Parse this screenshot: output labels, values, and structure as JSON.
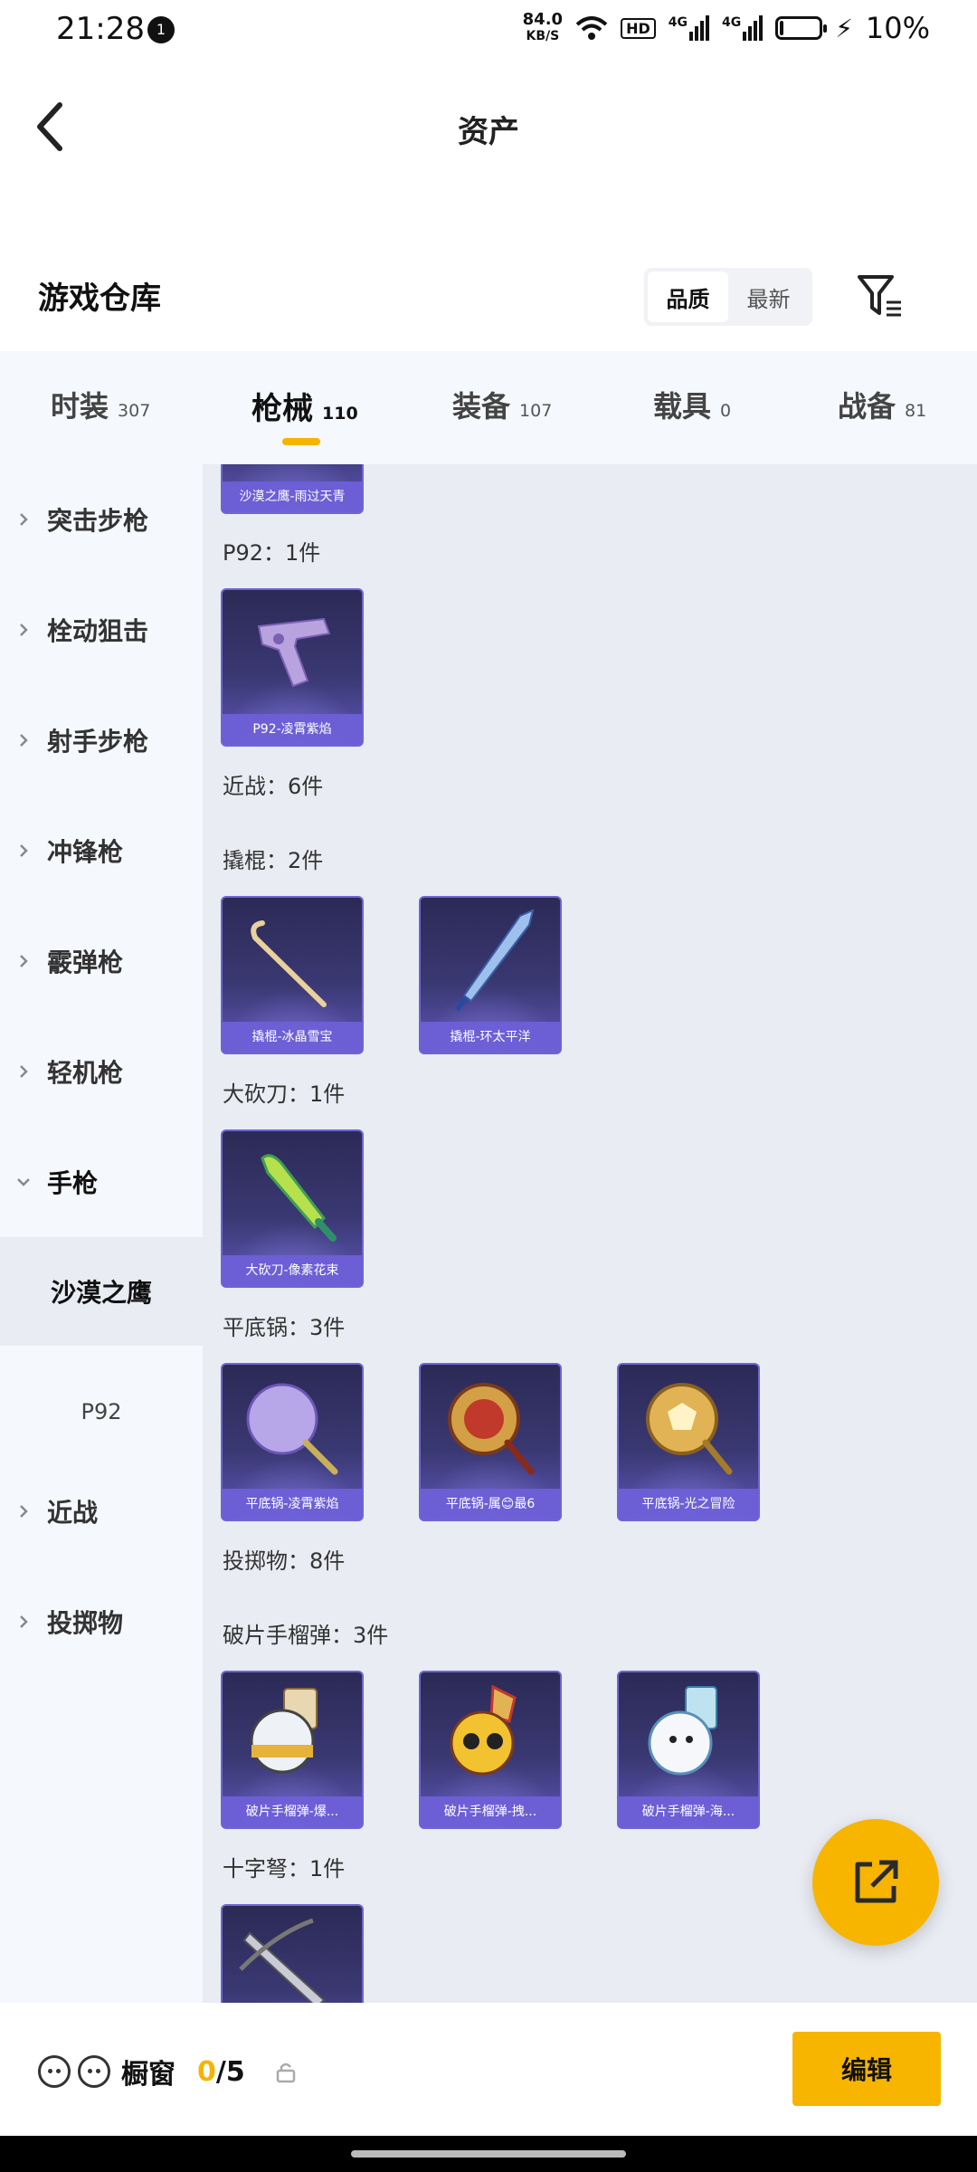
{
  "status_bar": {
    "time": "21:28",
    "notification_count": "1",
    "net_speed": "84.0",
    "net_unit": "KB/S",
    "hd": "HD",
    "signal1": "4G",
    "signal2": "4G",
    "battery": "10%",
    "battery_level": 0.1
  },
  "header": {
    "title": "资产"
  },
  "section": {
    "title": "游戏仓库"
  },
  "sort": {
    "quality": "品质",
    "latest": "最新",
    "active": "quality"
  },
  "tabs": [
    {
      "label": "时装",
      "count": "307"
    },
    {
      "label": "枪械",
      "count": "110"
    },
    {
      "label": "装备",
      "count": "107"
    },
    {
      "label": "载具",
      "count": "0"
    },
    {
      "label": "战备",
      "count": "81"
    }
  ],
  "active_tab": 1,
  "sidebar": {
    "items": [
      {
        "label": "突击步枪"
      },
      {
        "label": "栓动狙击"
      },
      {
        "label": "射手步枪"
      },
      {
        "label": "冲锋枪"
      },
      {
        "label": "霰弹枪"
      },
      {
        "label": "轻机枪"
      },
      {
        "label": "手枪"
      },
      {
        "label": "近战"
      },
      {
        "label": "投掷物"
      }
    ],
    "sub_items": [
      {
        "label": "沙漠之鹰"
      },
      {
        "label": "P92"
      }
    ]
  },
  "content": {
    "top_card": "沙漠之鹰-雨过天青",
    "groups": [
      {
        "label": "P92：1件",
        "cards": [
          "P92-凌霄紫焰"
        ]
      },
      {
        "label": "近战：6件",
        "cards": []
      },
      {
        "label": "撬棍：2件",
        "cards": [
          "撬棍-冰晶雪宝",
          "撬棍-环太平洋"
        ]
      },
      {
        "label": "大砍刀：1件",
        "cards": [
          "大砍刀-像素花束"
        ]
      },
      {
        "label": "平底锅：3件",
        "cards": [
          "平底锅-凌霄紫焰",
          "平底锅-属😊最6",
          "平底锅-光之冒险"
        ]
      },
      {
        "label": "投掷物：8件",
        "cards": []
      },
      {
        "label": "破片手榴弹：3件",
        "cards": [
          "破片手榴弹-爆...",
          "破片手榴弹-拽...",
          "破片手榴弹-海..."
        ]
      },
      {
        "label": "十字弩：1件",
        "cards": []
      }
    ]
  },
  "bottom": {
    "showcase_label": "橱窗",
    "count_current": "0",
    "count_total": "/5",
    "edit_label": "编辑"
  },
  "icons": {
    "back": "chevron-left-icon",
    "filter": "filter-icon",
    "share": "external-link-icon",
    "lock": "lock-icon"
  },
  "colors": {
    "accent": "#f7b500",
    "card_bg": "#3a3872",
    "card_caption": "#6e5fd7"
  }
}
